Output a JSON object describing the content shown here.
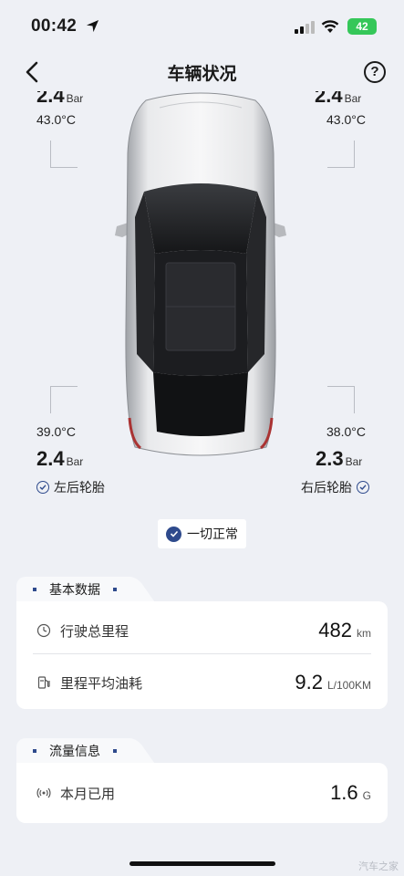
{
  "status_bar": {
    "time": "00:42",
    "battery": "42"
  },
  "nav": {
    "title": "车辆状况",
    "help": "?"
  },
  "tires": {
    "front_left": {
      "pressure": "2.4",
      "unit": "Bar",
      "temp": "43.0°C"
    },
    "front_right": {
      "pressure": "2.4",
      "unit": "Bar",
      "temp": "43.0°C"
    },
    "rear_left": {
      "pressure": "2.4",
      "unit": "Bar",
      "temp": "39.0°C",
      "name": "左后轮胎"
    },
    "rear_right": {
      "pressure": "2.3",
      "unit": "Bar",
      "temp": "38.0°C",
      "name": "右后轮胎"
    }
  },
  "status_pill": {
    "label": "一切正常"
  },
  "basic_data": {
    "title": "基本数据",
    "rows": [
      {
        "label": "行驶总里程",
        "value": "482",
        "unit": "km",
        "icon": "speedometer-icon"
      },
      {
        "label": "里程平均油耗",
        "value": "9.2",
        "unit": "L/100KM",
        "icon": "fuel-icon"
      }
    ]
  },
  "traffic_info": {
    "title": "流量信息",
    "rows": [
      {
        "label": "本月已用",
        "value": "1.6",
        "unit": "G",
        "icon": "signal-icon"
      }
    ]
  },
  "watermark": "汽车之家",
  "colors": {
    "accent": "#2e4a8c",
    "background": "#eef0f5",
    "battery": "#35c759"
  }
}
